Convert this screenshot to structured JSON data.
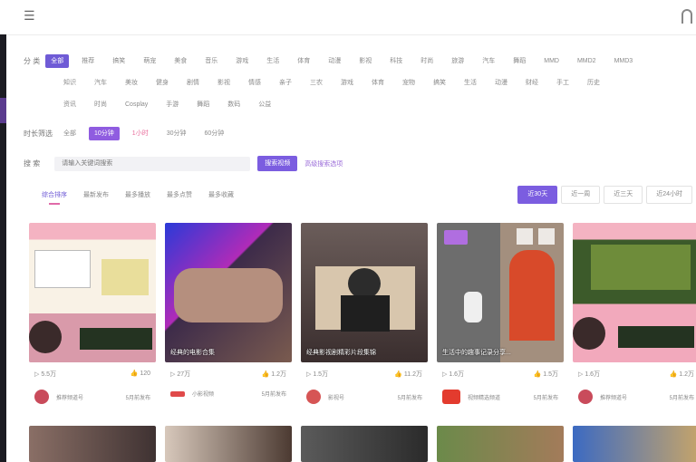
{
  "header": {
    "menu_icon": "menu-icon",
    "support_icon": "headset-icon"
  },
  "filters": {
    "category": {
      "label": "分 类",
      "rows": [
        [
          "全部",
          "推荐",
          "搞笑",
          "萌宠",
          "美食",
          "音乐",
          "游戏",
          "生活",
          "体育",
          "动漫",
          "影视",
          "科技",
          "时尚",
          "旅游",
          "汽车",
          "舞蹈",
          "MMD",
          "MMD2",
          "MMD3"
        ],
        [
          "知识",
          "汽车",
          "美妆",
          "健身",
          "剧情",
          "影视",
          "情感",
          "亲子",
          "三农",
          "游戏",
          "体育",
          "宠物",
          "搞笑",
          "生活",
          "动漫",
          "财经",
          "手工",
          "历史"
        ],
        [
          "资讯",
          "时尚",
          "Cosplay",
          "手游",
          "舞蹈",
          "数码",
          "公益"
        ]
      ],
      "active_index": 0
    },
    "duration": {
      "label": "时长筛选",
      "options": [
        "全部",
        "10分钟",
        "1小时",
        "30分钟",
        "60分钟"
      ],
      "active_index": 1,
      "pink_index": 2
    },
    "search": {
      "label": "搜 索",
      "placeholder": "请输入关键词搜索",
      "button": "搜索视频",
      "link": "高级搜索选项"
    }
  },
  "sort_tabs": {
    "items": [
      "综合排序",
      "最新发布",
      "最多播放",
      "最多点赞",
      "最多收藏"
    ],
    "active_index": 0
  },
  "duration_tabs": {
    "items": [
      "近30天",
      "近一周",
      "近三天",
      "近24小时"
    ],
    "active_index": 0
  },
  "cards": [
    {
      "caption": "",
      "views": "5.5万",
      "likes": "120",
      "author": "推荐频道号",
      "date": "5月前发布",
      "avatar_color": "#c94b5b"
    },
    {
      "caption": "经典的电影合集",
      "views": "27万",
      "likes": "1.2万",
      "author": "小影视频",
      "date": "5月前发布",
      "avatar_color": "#e04a4a"
    },
    {
      "caption": "经典影视剧精彩片段集锦",
      "views": "1.5万",
      "likes": "11.2万",
      "author": "影视号",
      "date": "5月前发布",
      "avatar_color": "#d65555"
    },
    {
      "caption": "生活中的趣事记录分享...",
      "views": "1.6万",
      "likes": "1.5万",
      "author": "视频精选频道",
      "date": "5月前发布",
      "avatar_color": "#e33b2e"
    },
    {
      "caption": "",
      "views": "1.6万",
      "likes": "1.2万",
      "author": "推荐频道号",
      "date": "5月前发布",
      "avatar_color": "#c94b5b"
    }
  ],
  "colors": {
    "accent": "#6f5bd6",
    "pink": "#e06aa8"
  }
}
